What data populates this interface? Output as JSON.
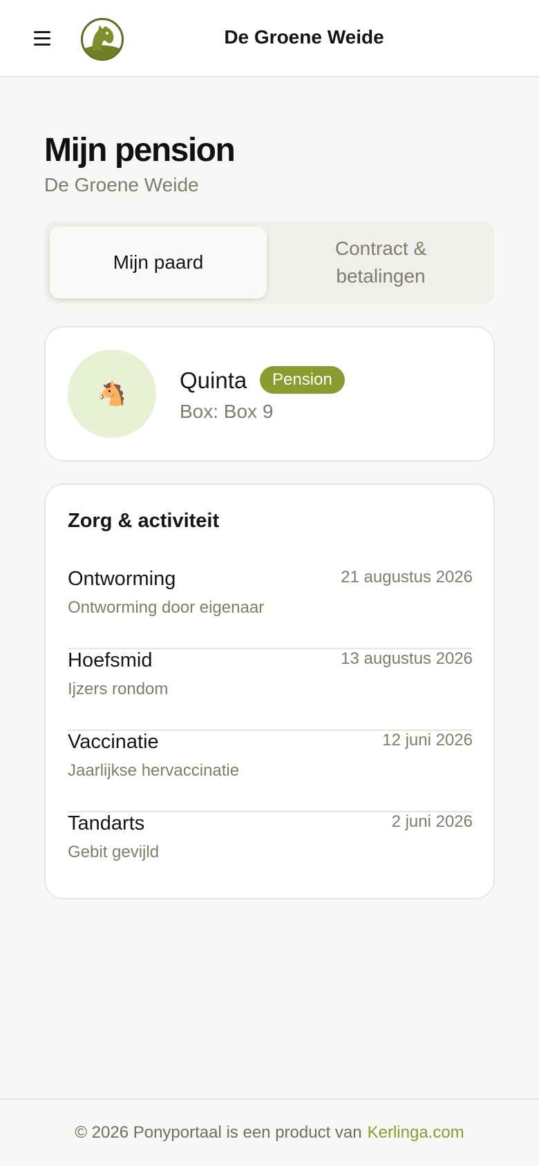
{
  "header": {
    "title": "De Groene Weide",
    "menu_icon": "hamburger-menu-icon",
    "logo": "horse-head-logo"
  },
  "page": {
    "title": "Mijn pension",
    "subtitle": "De Groene Weide"
  },
  "tabs": [
    {
      "label": "Mijn paard",
      "active": true
    },
    {
      "label": "Contract & betalingen",
      "active": false
    }
  ],
  "horse": {
    "avatar": "🐴",
    "name": "Quinta",
    "badge": "Pension",
    "box": "Box: Box 9"
  },
  "care": {
    "title": "Zorg & activiteit",
    "entries": [
      {
        "name": "Ontworming",
        "date": "21 augustus 2026",
        "note": "Ontworming door eigenaar"
      },
      {
        "name": "Hoefsmid",
        "date": "13 augustus 2026",
        "note": "Ijzers rondom"
      },
      {
        "name": "Vaccinatie",
        "date": "12 juni 2026",
        "note": "Jaarlijkse hervaccinatie"
      },
      {
        "name": "Tandarts",
        "date": "2 juni 2026",
        "note": "Gebit gevijld"
      }
    ]
  },
  "footer": {
    "text": "© 2026 Ponyportaal is een product van",
    "link": "Kerlinga.com"
  },
  "colors": {
    "accent": "#8a9b2f",
    "muted_text": "#7e7d6a",
    "avatar_bg": "#e9f1d5",
    "page_bg": "#f8f7f5"
  }
}
